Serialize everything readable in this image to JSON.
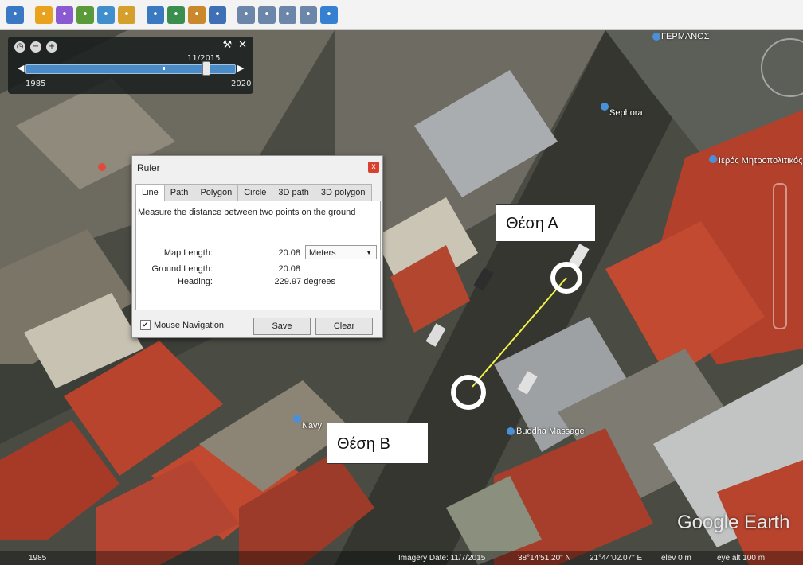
{
  "toolbar": {
    "buttons": [
      {
        "icon": "sidebar-icon",
        "color": "#3b78c4"
      },
      {
        "icon": "placemark-icon",
        "color": "#e8a21e"
      },
      {
        "icon": "polygon-icon",
        "color": "#8a5bd0"
      },
      {
        "icon": "path-icon",
        "color": "#5a9a3a"
      },
      {
        "icon": "image-overlay-icon",
        "color": "#3f8fcf"
      },
      {
        "icon": "record-tour-icon",
        "color": "#d4a02b"
      },
      {
        "icon": "historical-imagery-icon",
        "color": "#3a78c0"
      },
      {
        "icon": "sunlight-icon",
        "color": "#3a8f4f"
      },
      {
        "icon": "planets-icon",
        "color": "#c9882b"
      },
      {
        "icon": "ruler-icon",
        "color": "#3f6fb5"
      },
      {
        "icon": "email-icon",
        "color": "#6b86a8"
      },
      {
        "icon": "print-icon",
        "color": "#6b86a8"
      },
      {
        "icon": "save-image-icon",
        "color": "#6b86a8"
      },
      {
        "icon": "view-in-maps-icon",
        "color": "#6b86a8"
      },
      {
        "icon": "globe-icon",
        "color": "#3580d0"
      }
    ]
  },
  "time_slider": {
    "current_date": "11/2015",
    "start_year": "1985",
    "end_year": "2020"
  },
  "ruler": {
    "title": "Ruler",
    "close_label": "x",
    "tabs": [
      "Line",
      "Path",
      "Polygon",
      "Circle",
      "3D path",
      "3D polygon"
    ],
    "active_tab": "Line",
    "description": "Measure the distance between two points on the ground",
    "map_length_label": "Map Length:",
    "map_length_value": "20.08",
    "unit": "Meters",
    "ground_length_label": "Ground Length:",
    "ground_length_value": "20.08",
    "heading_label": "Heading:",
    "heading_value": "229.97 degrees",
    "mouse_nav_label": "Mouse Navigation",
    "mouse_nav_checked": true,
    "save_label": "Save",
    "clear_label": "Clear"
  },
  "annotations": {
    "thesi_a": "Θέση Α",
    "thesi_b": "Θέση Β"
  },
  "poi": {
    "germanos": "ΓΕΡΜΑΝΟΣ",
    "sephora": "Sephora",
    "metropolitan": "Ιερός Μητροπολιτικός",
    "navy": "Navy",
    "buddha": "Buddha Massage"
  },
  "status_bar": {
    "year_badge": "1985",
    "imagery_date": "Imagery Date: 11/7/2015",
    "lat": "38°14'51.20\" N",
    "lon": "21°44'02.07\" E",
    "elev": "elev   0 m",
    "eye_alt": "eye alt  100 m"
  },
  "watermark": "Google Earth",
  "colors": {
    "measure_line": "#f2f24a",
    "marker_ring": "#ffffff",
    "roof_red": "#b8442e",
    "street": "#3a3c38"
  }
}
